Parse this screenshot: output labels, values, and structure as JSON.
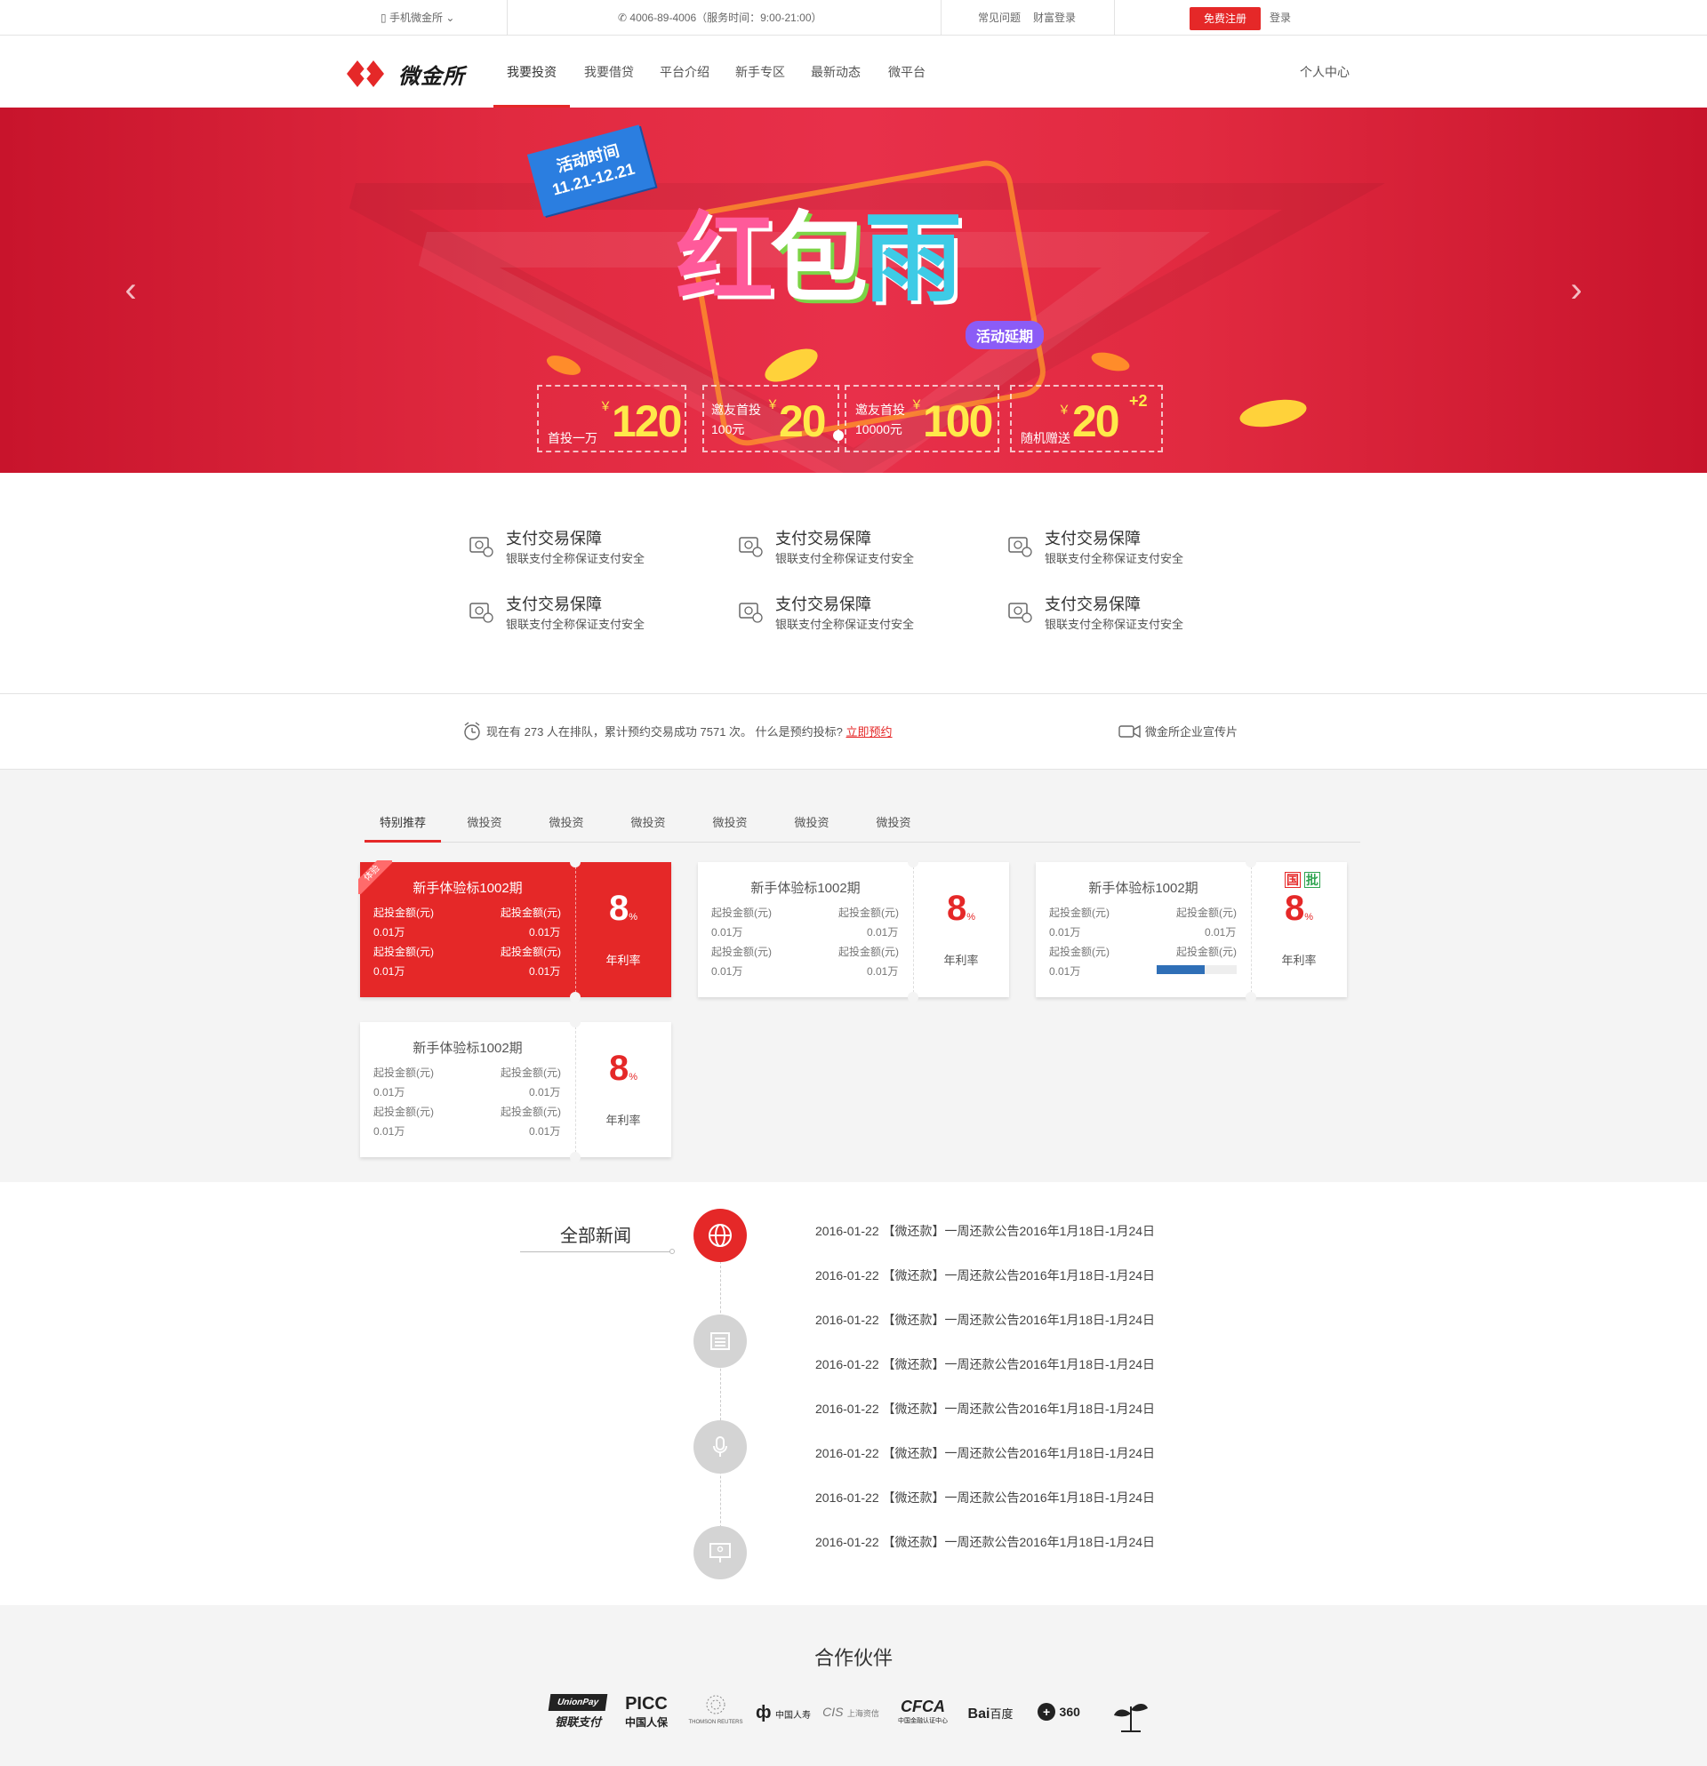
{
  "topbar": {
    "mobile": "手机微金所",
    "phone": "4006-89-4006（服务时间：9:00-21:00）",
    "faq": "常见问题",
    "wealth_login": "财富登录",
    "register": "免费注册",
    "login": "登录"
  },
  "nav": {
    "logo_text": "微金所",
    "items": [
      "我要投资",
      "我要借贷",
      "平台介绍",
      "新手专区",
      "最新动态",
      "微平台"
    ],
    "user_center": "个人中心"
  },
  "banner": {
    "date_label": "活动时间",
    "date_range": "11.21-12.21",
    "title_1": "红",
    "title_2": "包",
    "title_3": "雨",
    "extended": "活动延期",
    "coupons": [
      {
        "label": "首投一万",
        "yen": "￥",
        "amount": "120",
        "bg": "#e8306e"
      },
      {
        "label": "邀友首投",
        "label2": "100元",
        "yen": "￥",
        "amount": "20",
        "bg": "#ea3466"
      },
      {
        "label": "邀友首投",
        "label2": "10000元",
        "yen": "￥",
        "amount": "100",
        "bg": "#3aa9cf"
      },
      {
        "label": "随机赠送",
        "yen": "￥",
        "amount": "20",
        "plus": "+2",
        "bg": "#8a5fd6"
      }
    ]
  },
  "features": [
    {
      "title": "支付交易保障",
      "sub": "银联支付全称保证支付安全"
    },
    {
      "title": "支付交易保障",
      "sub": "银联支付全称保证支付安全"
    },
    {
      "title": "支付交易保障",
      "sub": "银联支付全称保证支付安全"
    },
    {
      "title": "支付交易保障",
      "sub": "银联支付全称保证支付安全"
    },
    {
      "title": "支付交易保障",
      "sub": "银联支付全称保证支付安全"
    },
    {
      "title": "支付交易保障",
      "sub": "银联支付全称保证支付安全"
    }
  ],
  "queue": {
    "text": "现在有 273 人在排队，累计预约交易成功 7571 次。 什么是预约投标?",
    "link": "立即预约",
    "video": "微金所企业宣传片"
  },
  "products": {
    "tabs": [
      "特别推荐",
      "微投资",
      "微投资",
      "微投资",
      "微投资",
      "微投资",
      "微投资"
    ],
    "cards": [
      {
        "name": "新手体验标1002期",
        "k": "起投金额(元)",
        "v": "0.01万",
        "rate": "8",
        "unit": "%",
        "rate_label": "年利率",
        "ribbon": "体验"
      },
      {
        "name": "新手体验标1002期",
        "k": "起投金额(元)",
        "v": "0.01万",
        "rate": "8",
        "unit": "%",
        "rate_label": "年利率"
      },
      {
        "name": "新手体验标1002期",
        "k": "起投金额(元)",
        "v": "0.01万",
        "rate": "8",
        "unit": "%",
        "rate_label": "年利率",
        "badge1": "国",
        "badge2": "批",
        "progress": 0.6
      },
      {
        "name": "新手体验标1002期",
        "k": "起投金额(元)",
        "v": "0.01万",
        "rate": "8",
        "unit": "%",
        "rate_label": "年利率"
      }
    ]
  },
  "news": {
    "title": "全部新闻",
    "items": [
      "2016-01-22 【微还款】一周还款公告2016年1月18日-1月24日",
      "2016-01-22 【微还款】一周还款公告2016年1月18日-1月24日",
      "2016-01-22 【微还款】一周还款公告2016年1月18日-1月24日",
      "2016-01-22 【微还款】一周还款公告2016年1月18日-1月24日",
      "2016-01-22 【微还款】一周还款公告2016年1月18日-1月24日",
      "2016-01-22 【微还款】一周还款公告2016年1月18日-1月24日",
      "2016-01-22 【微还款】一周还款公告2016年1月18日-1月24日",
      "2016-01-22 【微还款】一周还款公告2016年1月18日-1月24日"
    ]
  },
  "partners": {
    "title": "合作伙伴",
    "logos": [
      {
        "main": "UnionPay",
        "sub": "银联支付"
      },
      {
        "main": "PICC",
        "sub": "中国人保"
      },
      {
        "main": "",
        "sub": "THOMSON REUTERS"
      },
      {
        "main": "",
        "sub": "中国人寿"
      },
      {
        "main": "CIS",
        "sub": "上海资信"
      },
      {
        "main": "CFCA",
        "sub": "中国金融认证中心"
      },
      {
        "main": "Bai",
        "sub": "百度"
      },
      {
        "main": "360",
        "sub": ""
      },
      {
        "main": "",
        "sub": ""
      }
    ]
  }
}
